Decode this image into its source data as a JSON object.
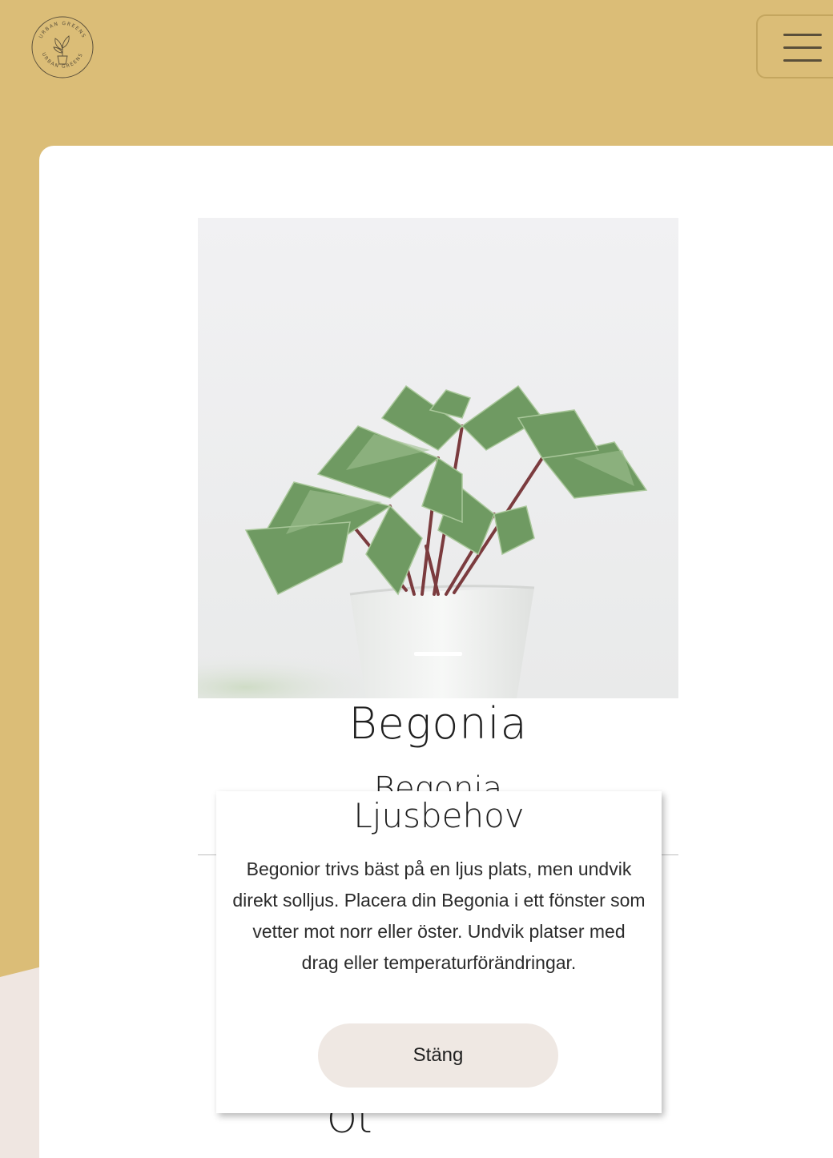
{
  "header": {
    "logo_text_top": "URBAN GREENS",
    "logo_text_bottom": "URBAN GREENS",
    "menu_icon": "hamburger-menu-icon"
  },
  "plant": {
    "name": "Begonia",
    "latin_name": "Begonia",
    "image_icon": "potted-begonia-plant-photo",
    "slide_count_visible": 1
  },
  "background_fragment": "Ot",
  "modal": {
    "title": "Ljusbehov",
    "body": "Begonior trivs bäst på en ljus plats, men undvik direkt solljus. Placera din Begonia i ett fönster som vetter mot norr eller öster. Undvik platser med drag eller temperaturförändringar.",
    "close_label": "Stäng"
  },
  "colors": {
    "background": "#dbbd77",
    "card": "#ffffff",
    "button": "#efe8e3",
    "text": "#1f1f1f"
  }
}
